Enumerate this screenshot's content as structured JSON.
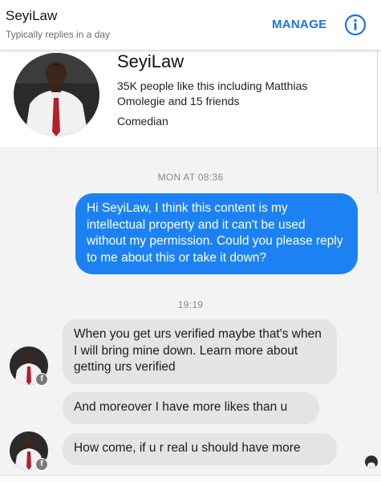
{
  "header": {
    "title": "SeyiLaw",
    "subtitle": "Typically replies in a day",
    "manage_label": "MANAGE",
    "info_icon": "info-icon",
    "accent_color": "#1a73e8"
  },
  "profile": {
    "name": "SeyiLaw",
    "likes_text": "35K people like this including Matthias Omolegie and 15 friends",
    "category": "Comedian"
  },
  "conversation": {
    "sent_color": "#1c82f4",
    "received_color": "#e4e4e4",
    "timestamps": [
      "MON AT 08:36",
      "19:19"
    ],
    "messages": [
      {
        "direction": "outgoing",
        "text": "Hi SeyiLaw, I think this content is my intellectual property and it can't be used without my permission. Could you please reply to me about this or take it down?"
      },
      {
        "direction": "incoming",
        "text": "When you get urs verified maybe that's when I will bring  mine down. Learn more about getting urs verified"
      },
      {
        "direction": "incoming",
        "text": "And moreover I have more likes than u"
      },
      {
        "direction": "incoming",
        "text": "How come,  if u r real u should have more"
      }
    ]
  }
}
